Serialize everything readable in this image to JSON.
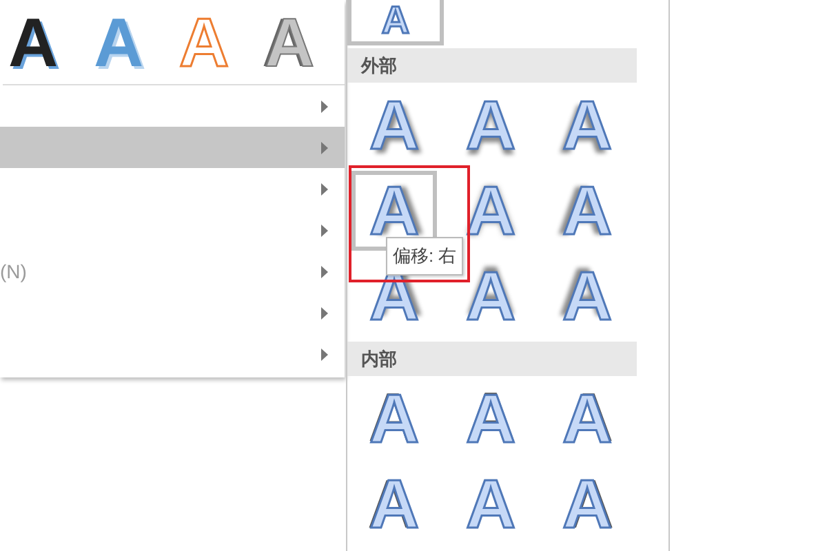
{
  "style_previews": [
    {
      "glyph": "A",
      "kind": "dark"
    },
    {
      "glyph": "A",
      "kind": "blue"
    },
    {
      "glyph": "A",
      "kind": "orange-outline"
    },
    {
      "glyph": "A",
      "kind": "grey"
    }
  ],
  "menu": {
    "items": [
      {
        "selected": false
      },
      {
        "selected": true
      },
      {
        "selected": false
      },
      {
        "selected": false
      },
      {
        "selected": false,
        "label": "(N)"
      },
      {
        "selected": false
      },
      {
        "selected": false
      }
    ]
  },
  "gallery": {
    "current": {
      "glyph": "A",
      "selected": true
    },
    "sections": [
      {
        "title": "外部",
        "items": [
          {
            "glyph": "A",
            "kind": "bottom-right",
            "selected": false
          },
          {
            "glyph": "A",
            "kind": "bottom",
            "selected": false
          },
          {
            "glyph": "A",
            "kind": "bottom-left",
            "selected": false
          },
          {
            "glyph": "A",
            "kind": "right",
            "selected": true,
            "tooltip": "偏移: 右",
            "highlighted": true
          },
          {
            "glyph": "A",
            "kind": "center",
            "selected": false
          },
          {
            "glyph": "A",
            "kind": "left",
            "selected": false
          },
          {
            "glyph": "A",
            "kind": "top-right",
            "selected": false
          },
          {
            "glyph": "A",
            "kind": "top",
            "selected": false
          },
          {
            "glyph": "A",
            "kind": "top-left",
            "selected": false
          }
        ]
      },
      {
        "title": "内部",
        "items": [
          {
            "glyph": "A",
            "kind": "inner-top-left",
            "selected": false
          },
          {
            "glyph": "A",
            "kind": "inner-top",
            "selected": false
          },
          {
            "glyph": "A",
            "kind": "inner-top-right",
            "selected": false
          },
          {
            "glyph": "A",
            "kind": "inner-left",
            "selected": false
          },
          {
            "glyph": "A",
            "kind": "inner-center",
            "selected": false
          },
          {
            "glyph": "A",
            "kind": "inner-right",
            "selected": false
          }
        ]
      }
    ]
  }
}
